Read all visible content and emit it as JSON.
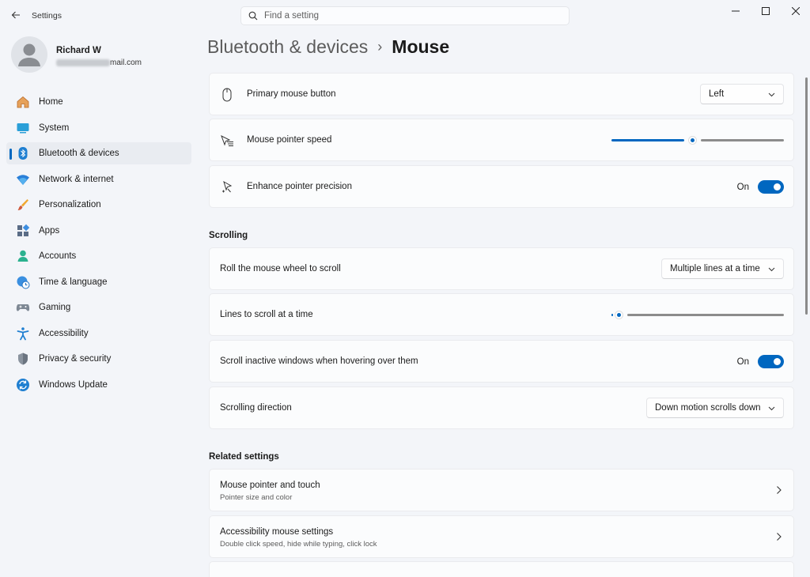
{
  "window": {
    "app_title": "Settings",
    "controls": [
      "minimize-icon",
      "maximize-icon",
      "close-icon"
    ]
  },
  "search": {
    "placeholder": "Find a setting"
  },
  "user": {
    "name": "Richard W",
    "email_visible": "mail.com"
  },
  "nav": {
    "items": [
      {
        "label": "Home",
        "icon": "home-icon"
      },
      {
        "label": "System",
        "icon": "system-icon"
      },
      {
        "label": "Bluetooth & devices",
        "icon": "bluetooth-icon",
        "active": true
      },
      {
        "label": "Network & internet",
        "icon": "wifi-icon"
      },
      {
        "label": "Personalization",
        "icon": "brush-icon"
      },
      {
        "label": "Apps",
        "icon": "apps-icon"
      },
      {
        "label": "Accounts",
        "icon": "accounts-icon"
      },
      {
        "label": "Time & language",
        "icon": "globe-clock-icon"
      },
      {
        "label": "Gaming",
        "icon": "gamepad-icon"
      },
      {
        "label": "Accessibility",
        "icon": "accessibility-icon"
      },
      {
        "label": "Privacy & security",
        "icon": "shield-icon"
      },
      {
        "label": "Windows Update",
        "icon": "update-icon"
      }
    ]
  },
  "breadcrumb": {
    "parent": "Bluetooth & devices",
    "separator": "›",
    "current": "Mouse"
  },
  "mouse": {
    "primary_button": {
      "label": "Primary mouse button",
      "value": "Left"
    },
    "pointer_speed": {
      "label": "Mouse pointer speed",
      "level": 0.47
    },
    "enhance_precision": {
      "label": "Enhance pointer precision",
      "state": "On"
    }
  },
  "scrolling": {
    "section_title": "Scrolling",
    "roll_wheel": {
      "label": "Roll the mouse wheel to scroll",
      "value": "Multiple lines at a time"
    },
    "lines_at_a_time": {
      "label": "Lines to scroll at a time",
      "level": 0.02
    },
    "inactive_windows": {
      "label": "Scroll inactive windows when hovering over them",
      "state": "On"
    },
    "direction": {
      "label": "Scrolling direction",
      "value": "Down motion scrolls down"
    }
  },
  "related": {
    "section_title": "Related settings",
    "items": [
      {
        "title": "Mouse pointer and touch",
        "subtitle": "Pointer size and color"
      },
      {
        "title": "Accessibility mouse settings",
        "subtitle": "Double click speed, hide while typing, click lock"
      }
    ]
  },
  "colors": {
    "accent": "#0067c0",
    "background": "#f3f5f9",
    "card": "#fbfcfd"
  }
}
